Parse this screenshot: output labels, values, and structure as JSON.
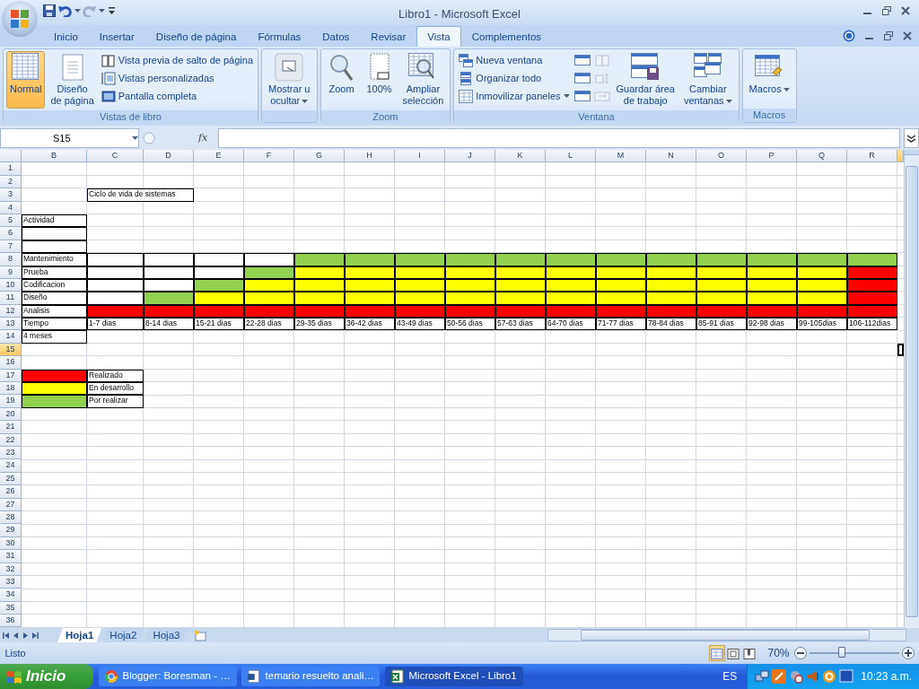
{
  "window": {
    "title": "Libro1 - Microsoft Excel"
  },
  "tabs": [
    {
      "label": "Inicio",
      "selected": false
    },
    {
      "label": "Insertar",
      "selected": false
    },
    {
      "label": "Diseño de página",
      "selected": false
    },
    {
      "label": "Fórmulas",
      "selected": false
    },
    {
      "label": "Datos",
      "selected": false
    },
    {
      "label": "Revisar",
      "selected": false
    },
    {
      "label": "Vista",
      "selected": true
    },
    {
      "label": "Complementos",
      "selected": false
    }
  ],
  "ribbon": {
    "groups": [
      {
        "label": "Vistas de libro",
        "items": [
          {
            "kind": "large",
            "label": "Normal",
            "selected": true
          },
          {
            "kind": "large",
            "label": "Diseño\nde página",
            "selected": false
          },
          {
            "kind": "small",
            "label": "Vista previa de salto de página"
          },
          {
            "kind": "small",
            "label": "Vistas personalizadas"
          },
          {
            "kind": "small",
            "label": "Pantalla completa"
          }
        ]
      },
      {
        "items": [
          {
            "kind": "large",
            "label": "Mostrar u\nocultar",
            "dropdown": true,
            "selected": false
          }
        ]
      },
      {
        "label": "Zoom",
        "items": [
          {
            "kind": "large",
            "label": "Zoom",
            "selected": false
          },
          {
            "kind": "large",
            "label": "100%",
            "selected": false
          },
          {
            "kind": "large",
            "label": "Ampliar\nselección",
            "selected": false
          }
        ]
      },
      {
        "label": "Ventana",
        "items": [
          {
            "kind": "small",
            "label": "Nueva ventana"
          },
          {
            "kind": "small",
            "label": "Organizar todo"
          },
          {
            "kind": "small",
            "label": "Inmovilizar paneles",
            "dropdown": true
          },
          {
            "kind": "icon",
            "disabled": false
          },
          {
            "kind": "icon",
            "disabled": false
          },
          {
            "kind": "icon",
            "disabled": false
          },
          {
            "kind": "icon",
            "disabled": true
          },
          {
            "kind": "icon",
            "disabled": true
          },
          {
            "kind": "icon",
            "disabled": true
          },
          {
            "kind": "large",
            "label": "Guardar área\nde trabajo",
            "selected": false
          },
          {
            "kind": "large",
            "label": "Cambiar\nventanas",
            "dropdown": true,
            "selected": false
          }
        ]
      },
      {
        "label": "Macros",
        "items": [
          {
            "kind": "large",
            "label": "Macros",
            "dropdown": true,
            "selected": false
          }
        ]
      }
    ]
  },
  "formula_bar": {
    "name_box": "S15",
    "function_label": "fx"
  },
  "sheet": {
    "columns": [
      "B",
      "C",
      "D",
      "E",
      "F",
      "G",
      "H",
      "I",
      "J",
      "K",
      "L",
      "M",
      "N",
      "O",
      "P",
      "Q",
      "R"
    ],
    "rows": [
      {
        "number": "1",
        "selected": false
      },
      {
        "number": "2",
        "selected": false
      },
      {
        "number": "3",
        "selected": false,
        "cells": [
          {},
          {
            "text": "Ciclo de vida de sistemas",
            "bordered": true,
            "merged": true
          }
        ]
      },
      {
        "number": "4",
        "selected": false
      },
      {
        "number": "5",
        "selected": false,
        "cells": [
          {
            "text": "Actividad",
            "bordered": true
          }
        ]
      },
      {
        "number": "6",
        "selected": false,
        "cells": [
          {
            "bordered": true
          }
        ]
      },
      {
        "number": "7",
        "selected": false,
        "cells": [
          {
            "bordered": true
          }
        ]
      },
      {
        "number": "8",
        "selected": false,
        "cells": [
          {
            "text": "Mantenimiento",
            "bordered": true
          },
          {
            "bordered": true
          },
          {
            "bordered": true
          },
          {
            "bordered": true
          },
          {
            "bordered": true
          },
          {
            "color": "#92d050"
          },
          {
            "color": "#92d050"
          },
          {
            "color": "#92d050"
          },
          {
            "color": "#92d050"
          },
          {
            "color": "#92d050"
          },
          {
            "color": "#92d050"
          },
          {
            "color": "#92d050"
          },
          {
            "color": "#92d050"
          },
          {
            "color": "#92d050"
          },
          {
            "color": "#92d050"
          },
          {
            "color": "#92d050"
          },
          {
            "color": "#92d050"
          }
        ]
      },
      {
        "number": "9",
        "selected": false,
        "cells": [
          {
            "text": "Prueba",
            "bordered": true
          },
          {
            "bordered": true
          },
          {
            "bordered": true
          },
          {
            "bordered": true
          },
          {
            "color": "#92d050"
          },
          {
            "color": "#ffff00"
          },
          {
            "color": "#ffff00"
          },
          {
            "color": "#ffff00"
          },
          {
            "color": "#ffff00"
          },
          {
            "color": "#ffff00"
          },
          {
            "color": "#ffff00"
          },
          {
            "color": "#ffff00"
          },
          {
            "color": "#ffff00"
          },
          {
            "color": "#ffff00"
          },
          {
            "color": "#ffff00"
          },
          {
            "color": "#ffff00"
          },
          {
            "color": "#ff0000"
          }
        ]
      },
      {
        "number": "10",
        "selected": false,
        "cells": [
          {
            "text": "Codificacion",
            "bordered": true
          },
          {
            "bordered": true
          },
          {
            "bordered": true
          },
          {
            "color": "#92d050"
          },
          {
            "color": "#ffff00"
          },
          {
            "color": "#ffff00"
          },
          {
            "color": "#ffff00"
          },
          {
            "color": "#ffff00"
          },
          {
            "color": "#ffff00"
          },
          {
            "color": "#ffff00"
          },
          {
            "color": "#ffff00"
          },
          {
            "color": "#ffff00"
          },
          {
            "color": "#ffff00"
          },
          {
            "color": "#ffff00"
          },
          {
            "color": "#ffff00"
          },
          {
            "color": "#ffff00"
          },
          {
            "color": "#ff0000"
          }
        ]
      },
      {
        "number": "11",
        "selected": false,
        "cells": [
          {
            "text": "Diseño",
            "bordered": true
          },
          {
            "bordered": true
          },
          {
            "color": "#92d050"
          },
          {
            "color": "#ffff00"
          },
          {
            "color": "#ffff00"
          },
          {
            "color": "#ffff00"
          },
          {
            "color": "#ffff00"
          },
          {
            "color": "#ffff00"
          },
          {
            "color": "#ffff00"
          },
          {
            "color": "#ffff00"
          },
          {
            "color": "#ffff00"
          },
          {
            "color": "#ffff00"
          },
          {
            "color": "#ffff00"
          },
          {
            "color": "#ffff00"
          },
          {
            "color": "#ffff00"
          },
          {
            "color": "#ffff00"
          },
          {
            "color": "#ff0000"
          }
        ]
      },
      {
        "number": "12",
        "selected": false,
        "cells": [
          {
            "text": "Analisis",
            "bordered": true
          },
          {
            "color": "#ff0000"
          },
          {
            "color": "#ff0000"
          },
          {
            "color": "#ff0000"
          },
          {
            "color": "#ff0000"
          },
          {
            "color": "#ff0000"
          },
          {
            "color": "#ff0000"
          },
          {
            "color": "#ff0000"
          },
          {
            "color": "#ff0000"
          },
          {
            "color": "#ff0000"
          },
          {
            "color": "#ff0000"
          },
          {
            "color": "#ff0000"
          },
          {
            "color": "#ff0000"
          },
          {
            "color": "#ff0000"
          },
          {
            "color": "#ff0000"
          },
          {
            "color": "#ff0000"
          },
          {
            "color": "#ff0000"
          }
        ]
      },
      {
        "number": "13",
        "selected": false,
        "cells": [
          {
            "text": "Tiempo",
            "bordered": true
          },
          {
            "text": "1-7 dias",
            "bordered": true
          },
          {
            "text": "8-14 dias",
            "bordered": true
          },
          {
            "text": "15-21 dias",
            "bordered": true
          },
          {
            "text": "22-28 dias",
            "bordered": true
          },
          {
            "text": "29-35 dias",
            "bordered": true
          },
          {
            "text": "36-42 dias",
            "bordered": true
          },
          {
            "text": "43-49 dias",
            "bordered": true
          },
          {
            "text": "50-56 dias",
            "bordered": true
          },
          {
            "text": "57-63 dias",
            "bordered": true
          },
          {
            "text": "64-70 dias",
            "bordered": true
          },
          {
            "text": "71-77 dias",
            "bordered": true
          },
          {
            "text": "78-84 dias",
            "bordered": true
          },
          {
            "text": "85-91 dias",
            "bordered": true
          },
          {
            "text": "92-98 dias",
            "bordered": true
          },
          {
            "text": "99-105dias",
            "bordered": true
          },
          {
            "text": "106-112dias",
            "bordered": true
          }
        ]
      },
      {
        "number": "14",
        "selected": false,
        "cells": [
          {
            "text": "4 meses",
            "bordered": true
          }
        ]
      },
      {
        "number": "15",
        "selected": true
      },
      {
        "number": "16",
        "selected": false
      },
      {
        "number": "17",
        "selected": false,
        "cells": [
          {
            "color": "#ff0000"
          },
          {
            "text": "Realizado",
            "bordered": true
          }
        ]
      },
      {
        "number": "18",
        "selected": false,
        "cells": [
          {
            "color": "#ffff00"
          },
          {
            "text": "En desarrollo",
            "bordered": true
          }
        ]
      },
      {
        "number": "19",
        "selected": false,
        "cells": [
          {
            "color": "#92d050"
          },
          {
            "text": "Por realizar",
            "bordered": true
          }
        ]
      },
      {
        "number": "20",
        "selected": false
      },
      {
        "number": "21",
        "selected": false
      },
      {
        "number": "22",
        "selected": false
      },
      {
        "number": "23",
        "selected": false
      },
      {
        "number": "24",
        "selected": false
      },
      {
        "number": "25",
        "selected": false
      },
      {
        "number": "26",
        "selected": false
      },
      {
        "number": "27",
        "selected": false
      },
      {
        "number": "28",
        "selected": false
      },
      {
        "number": "29",
        "selected": false
      },
      {
        "number": "30",
        "selected": false
      },
      {
        "number": "31",
        "selected": false
      },
      {
        "number": "32",
        "selected": false
      },
      {
        "number": "33",
        "selected": false
      },
      {
        "number": "34",
        "selected": false
      },
      {
        "number": "35",
        "selected": false
      },
      {
        "number": "36",
        "selected": false
      }
    ]
  },
  "sheet_tabs": [
    {
      "label": "Hoja1",
      "selected": true
    },
    {
      "label": "Hoja2",
      "selected": false
    },
    {
      "label": "Hoja3",
      "selected": false
    }
  ],
  "status_bar": {
    "text": "Listo",
    "views": [
      {
        "selected": true
      },
      {
        "selected": false
      },
      {
        "selected": false
      }
    ],
    "zoom": "70%",
    "zoom_slider": {
      "level": 0.36
    }
  },
  "taskbar": {
    "start": "Inicio",
    "tasks": [
      {
        "label": "Blogger: Boresman - …",
        "selected": false
      },
      {
        "label": "temario resuelto anali…",
        "selected": false
      },
      {
        "label": "Microsoft Excel - Libro1",
        "selected": true
      }
    ],
    "language": "ES",
    "clock": "10:23 a.m."
  }
}
